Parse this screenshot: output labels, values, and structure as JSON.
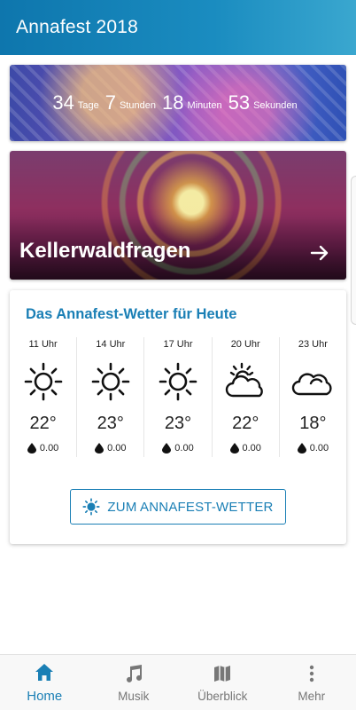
{
  "app": {
    "title": "Annafest 2018"
  },
  "countdown": {
    "days": "34",
    "days_label": "Tage",
    "hours": "7",
    "hours_label": "Stunden",
    "minutes": "18",
    "minutes_label": "Minuten",
    "seconds": "53",
    "seconds_label": "Sekunden"
  },
  "banner": {
    "title": "Kellerwaldfragen",
    "icon": "arrow-right-icon"
  },
  "weather": {
    "heading": "Das Annafest-Wetter für Heute",
    "forecast": [
      {
        "time": "11 Uhr",
        "icon": "sun-icon",
        "temp": "22°",
        "rain": "0.00"
      },
      {
        "time": "14 Uhr",
        "icon": "sun-icon",
        "temp": "23°",
        "rain": "0.00"
      },
      {
        "time": "17 Uhr",
        "icon": "sun-icon",
        "temp": "23°",
        "rain": "0.00"
      },
      {
        "time": "20 Uhr",
        "icon": "partly-cloudy-icon",
        "temp": "22°",
        "rain": "0.00"
      },
      {
        "time": "23 Uhr",
        "icon": "cloud-icon",
        "temp": "18°",
        "rain": "0.00"
      }
    ],
    "button_label": "ZUM ANNAFEST-WETTER",
    "accent": "#1a7fb5"
  },
  "nav": {
    "items": [
      {
        "label": "Home",
        "icon": "home-icon",
        "active": true
      },
      {
        "label": "Musik",
        "icon": "music-note-icon",
        "active": false
      },
      {
        "label": "Überblick",
        "icon": "map-icon",
        "active": false
      },
      {
        "label": "Mehr",
        "icon": "more-vertical-icon",
        "active": false
      }
    ]
  }
}
